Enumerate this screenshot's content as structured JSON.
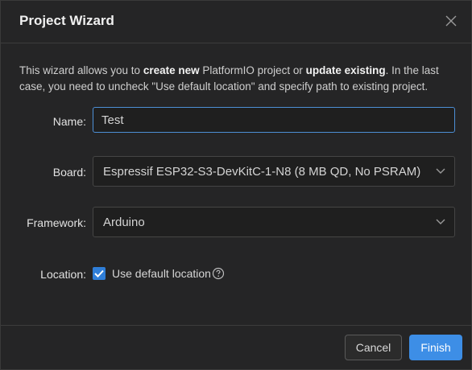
{
  "dialog": {
    "title": "Project Wizard"
  },
  "intro": {
    "part1": "This wizard allows you to ",
    "bold1": "create new",
    "part2": " PlatformIO project or ",
    "bold2": "update existing",
    "part3": ". In the last case, you need to uncheck \"Use default location\" and specify path to existing project."
  },
  "form": {
    "name_label": "Name:",
    "name_value": "Test",
    "board_label": "Board:",
    "board_value": "Espressif ESP32-S3-DevKitC-1-N8 (8 MB QD, No PSRAM)",
    "framework_label": "Framework:",
    "framework_value": "Arduino",
    "location_label": "Location:",
    "use_default_label": "Use default location",
    "use_default_checked": true
  },
  "footer": {
    "cancel_label": "Cancel",
    "finish_label": "Finish"
  },
  "colors": {
    "accent": "#3d8ee6",
    "background": "#252526"
  }
}
